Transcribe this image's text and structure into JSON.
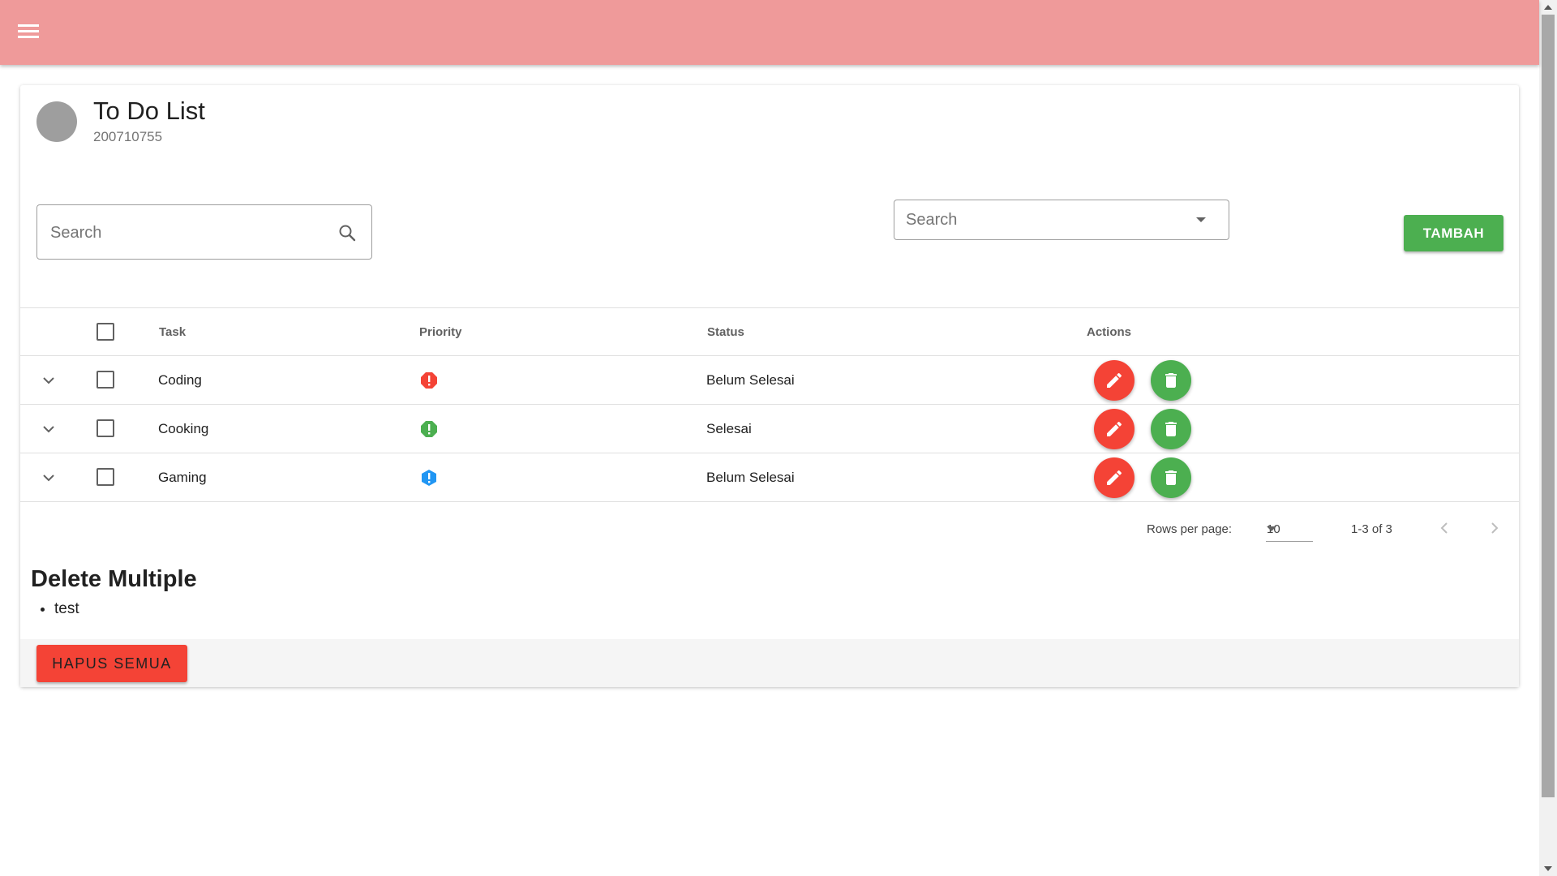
{
  "app": {
    "menu_icon": "hamburger-menu-icon",
    "bar_color": "#ef9a9a"
  },
  "header": {
    "title": "To Do List",
    "subtitle": "200710755"
  },
  "search": {
    "placeholder": "Search",
    "value": ""
  },
  "filter": {
    "placeholder": "Search"
  },
  "add_button": {
    "label": "TAMBAH",
    "color": "#4caf50"
  },
  "table": {
    "columns": [
      "Task",
      "Priority",
      "Status",
      "Actions"
    ],
    "rows": [
      {
        "task": "Coding",
        "priority_color": "#f44336",
        "status": "Belum Selesai"
      },
      {
        "task": "Cooking",
        "priority_color": "#4caf50",
        "status": "Selesai"
      },
      {
        "task": "Gaming",
        "priority_color": "#2196f3",
        "status": "Belum Selesai"
      }
    ]
  },
  "pagination": {
    "rows_label": "Rows per page:",
    "rows_value": "10",
    "range": "1-3 of 3"
  },
  "delete_section": {
    "title": "Delete Multiple",
    "items": [
      "test"
    ],
    "button": "HAPUS SEMUA",
    "button_color": "#f44336"
  }
}
